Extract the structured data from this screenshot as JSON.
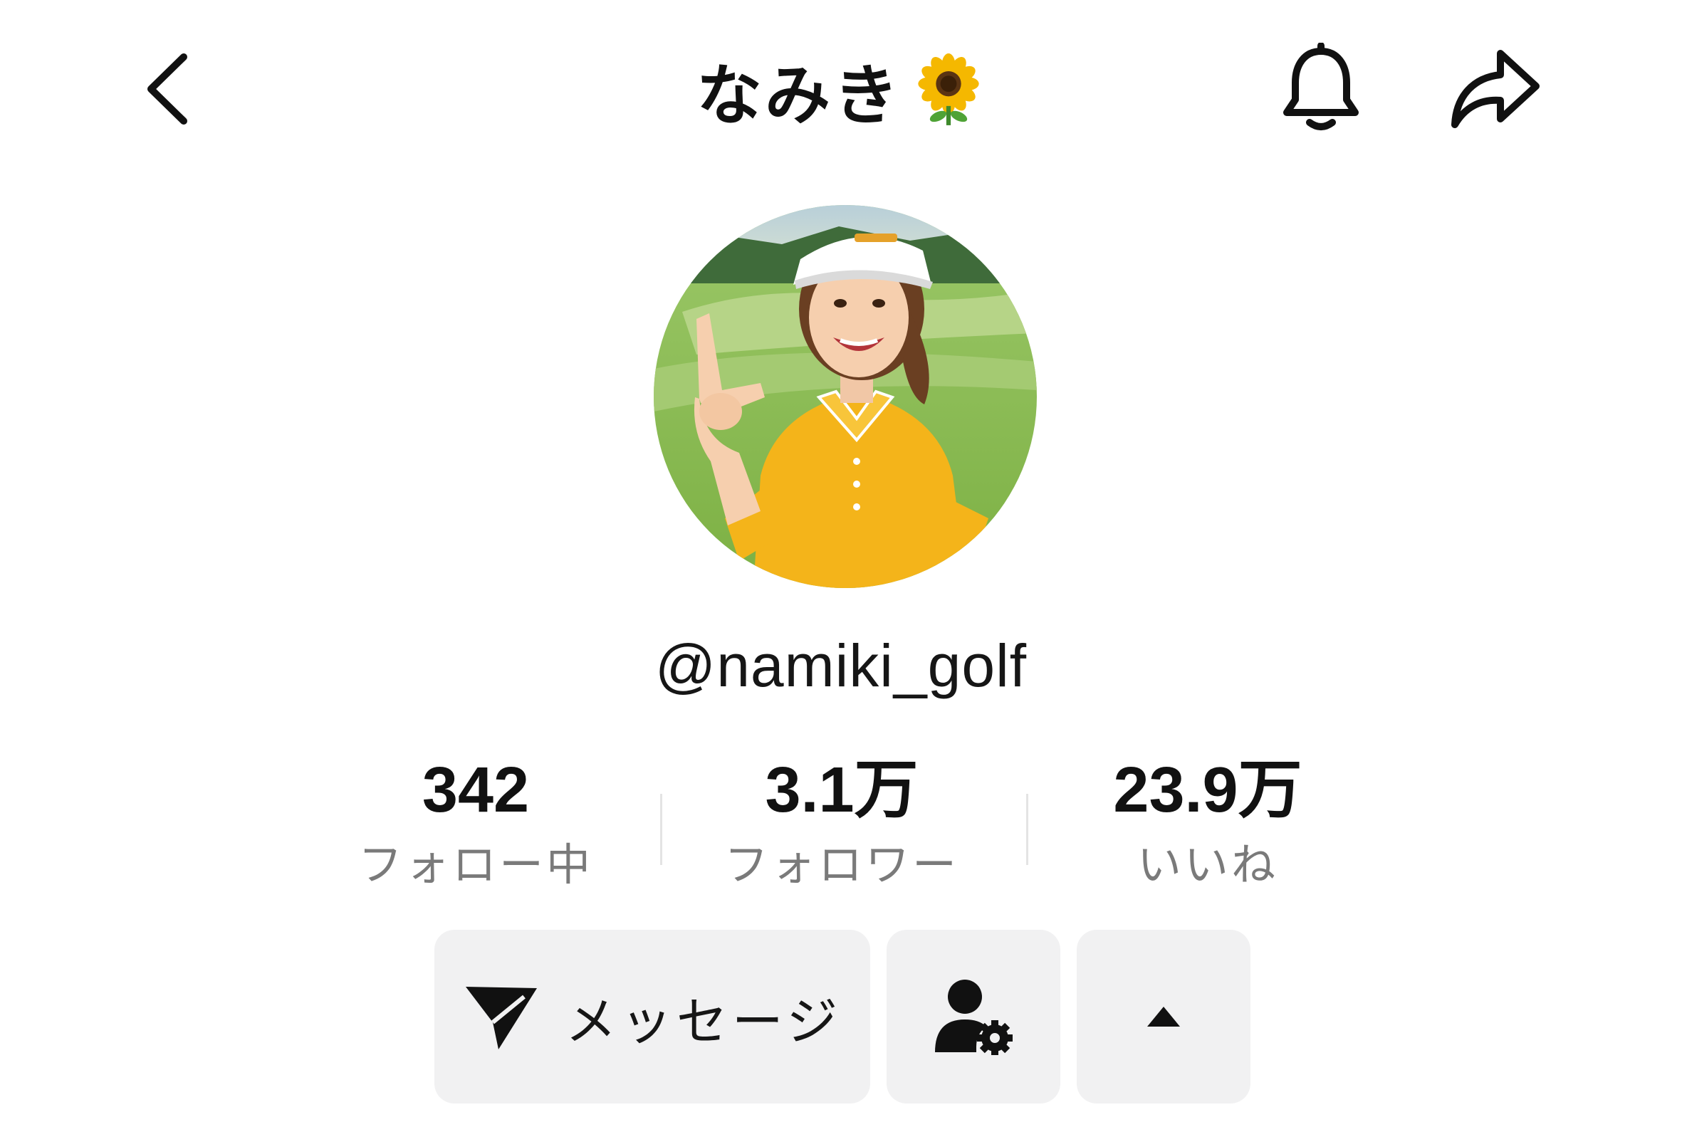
{
  "header": {
    "title": "なみき",
    "title_emoji": "sunflower-emoji",
    "back_icon": "chevron-left-icon",
    "notification_icon": "bell-icon",
    "share_icon": "share-arrow-icon"
  },
  "profile": {
    "username": "@namiki_golf",
    "avatar_description": "profile-photo"
  },
  "stats": [
    {
      "value": "342",
      "label": "フォロー中"
    },
    {
      "value": "3.1万",
      "label": "フォロワー"
    },
    {
      "value": "23.9万",
      "label": "いいね"
    }
  ],
  "actions": {
    "message_label": "メッセージ",
    "message_icon": "send-icon",
    "friend_icon": "user-settings-icon",
    "more_icon": "caret-up-icon"
  },
  "colors": {
    "background": "#ffffff",
    "button_bg": "#f1f1f2",
    "text_primary": "#111111",
    "text_secondary": "#7a7a7a",
    "avatar_shirt": "#f4b41a",
    "avatar_grass": "#8fc056"
  }
}
